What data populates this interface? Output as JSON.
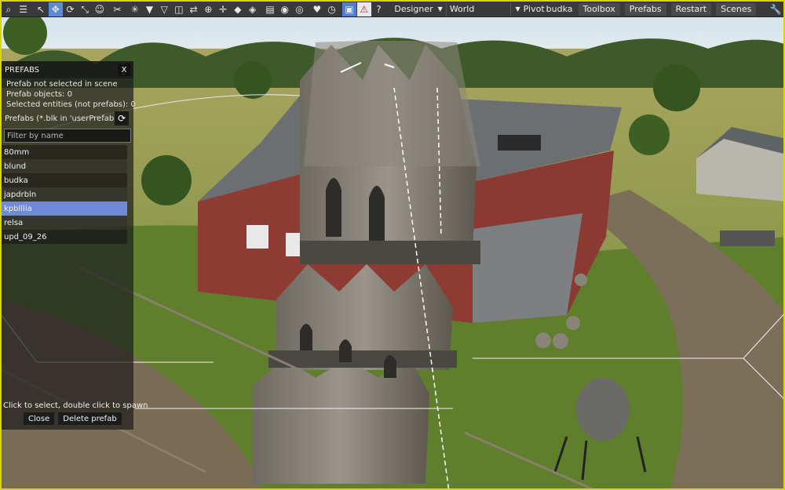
{
  "toolbar": {
    "icons": [
      "search-icon",
      "menu-icon",
      "select-arrow-icon",
      "move-icon",
      "rotate-icon",
      "scale-icon",
      "face-icon",
      "cut-icon",
      "snap-icon",
      "triangle-down-icon",
      "triangle-outline-icon",
      "mirror-icon",
      "swap-icon",
      "target-icon",
      "crosshair-icon",
      "diamond-icon",
      "prefab-icon",
      "document-icon",
      "eye-icon",
      "view-icon",
      "heart-icon",
      "timer-icon",
      "save-icon",
      "warning-icon",
      "help-icon",
      "wrench-icon"
    ],
    "mode_dropdown": "Designer",
    "space_dropdown": "World",
    "pivot_label": "Pivot",
    "toolbox_label": "Toolbox",
    "prefabs_label": "Prefabs",
    "restart_label": "Restart",
    "scenes_label": "Scenes",
    "overlap_label": "budka"
  },
  "prefabs_panel": {
    "title": "PREFABS",
    "close_label": "X",
    "info": [
      "Prefab not selected in scene",
      "Prefab objects: 0",
      "Selected entities (not prefabs): 0"
    ],
    "prefabs_path": "Prefabs (*.blk in 'userPrefabs' fc",
    "filter_placeholder": "Filter by name",
    "items": [
      "80mm",
      "blund",
      "budka",
      "japdrbln",
      "kpblllia",
      "relsa",
      "upd_09_26"
    ],
    "selected_item": "kpblllia",
    "hint": "Click to select, double click to spawn",
    "close_button": "Close",
    "delete_button": "Delete prefab"
  },
  "colors": {
    "viewport_border": "#d8d800",
    "selection": "#6f8ad8",
    "toolbar_bg": "#3a3a3a"
  }
}
